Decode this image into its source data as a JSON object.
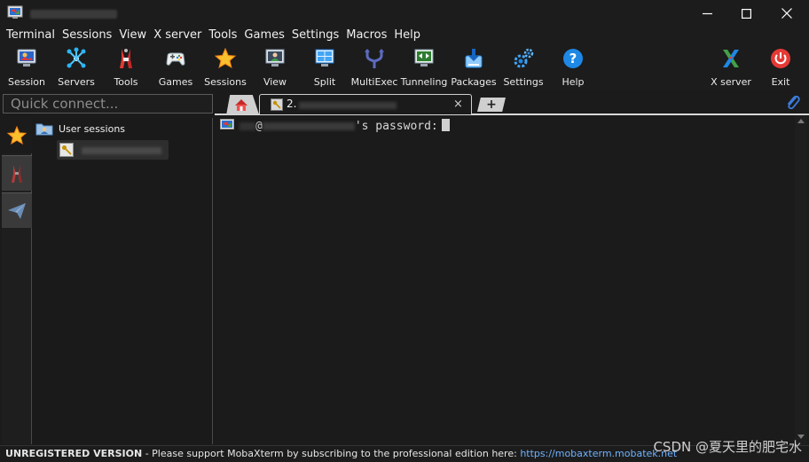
{
  "menu": [
    "Terminal",
    "Sessions",
    "View",
    "X server",
    "Tools",
    "Games",
    "Settings",
    "Macros",
    "Help"
  ],
  "toolbar": [
    {
      "label": "Session",
      "icon": "session-icon"
    },
    {
      "label": "Servers",
      "icon": "servers-icon"
    },
    {
      "label": "Tools",
      "icon": "tools-icon"
    },
    {
      "label": "Games",
      "icon": "games-icon"
    },
    {
      "label": "Sessions",
      "icon": "star-icon"
    },
    {
      "label": "View",
      "icon": "view-icon"
    },
    {
      "label": "Split",
      "icon": "split-icon"
    },
    {
      "label": "MultiExec",
      "icon": "multiexec-icon"
    },
    {
      "label": "Tunneling",
      "icon": "tunneling-icon"
    },
    {
      "label": "Packages",
      "icon": "packages-icon"
    },
    {
      "label": "Settings",
      "icon": "gears-icon"
    },
    {
      "label": "Help",
      "icon": "help-icon"
    },
    {
      "label": "X server",
      "icon": "x-server-icon"
    },
    {
      "label": "Exit",
      "icon": "power-icon"
    }
  ],
  "quick_connect": {
    "placeholder": "Quick connect..."
  },
  "tabs": {
    "session_prefix": "2.",
    "close": "×",
    "add": "+"
  },
  "sidebar": {
    "root_label": "User sessions"
  },
  "terminal": {
    "at": "@",
    "prompt": "'s password:"
  },
  "status": {
    "unregistered": "UNREGISTERED VERSION",
    "message": "  -  Please support MobaXterm by subscribing to the professional edition here:  ",
    "link": "https://mobaxterm.mobatek.net"
  },
  "watermark": "CSDN @夏天里的肥宅水",
  "colors": {
    "background": "#1b1b1b",
    "link": "#6fb3ff",
    "exit": "#e53935",
    "help": "#1e88e5"
  }
}
